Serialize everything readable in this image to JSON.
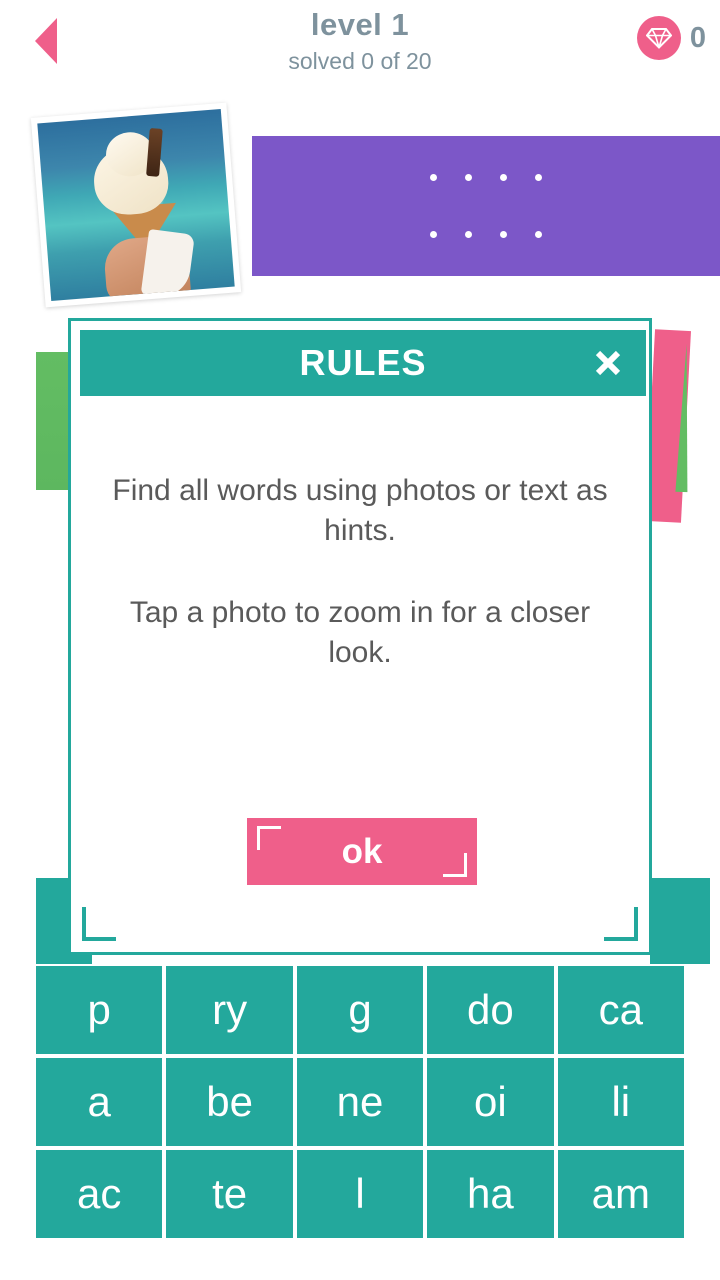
{
  "header": {
    "back_icon": "back-triangle-icon",
    "level_title": "level 1",
    "solved_text": "solved 0 of 20",
    "gem_icon": "diamond-icon",
    "gem_count": "0",
    "text_color": "#7e929d",
    "accent_pink": "#ef5f8a"
  },
  "puzzle": {
    "photo_alt": "ice cream cone held in hand at the beach",
    "answer_panel": {
      "color": "#7c57c8",
      "rows": [
        {
          "dots": 4
        },
        {
          "dots": 4
        }
      ]
    }
  },
  "dialog": {
    "title": "RULES",
    "close_icon": "close-x-icon",
    "paragraphs": [
      "Find all words using photos or text as hints.",
      "Tap a photo to zoom in for a closer look."
    ],
    "ok_label": "ok",
    "header_color": "#23a89c",
    "ok_color": "#ef5f8a"
  },
  "tiles": {
    "color": "#23a89c",
    "rows": [
      [
        "p",
        "ry",
        "g",
        "do",
        "ca"
      ],
      [
        "a",
        "be",
        "ne",
        "oi",
        "li"
      ],
      [
        "ac",
        "te",
        "l",
        "ha",
        "am"
      ]
    ]
  },
  "decor": {
    "green": "#63bd63",
    "pink": "#ef5f8a",
    "teal": "#23a89c"
  }
}
